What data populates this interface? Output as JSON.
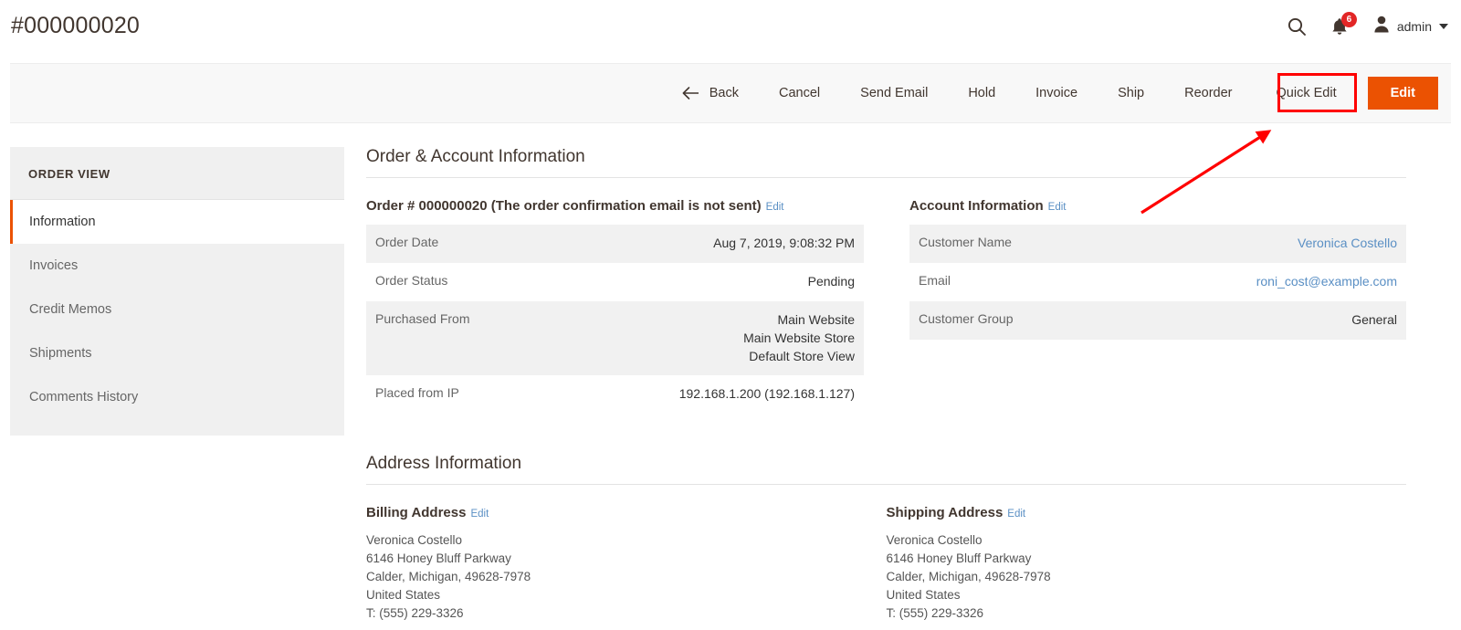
{
  "header": {
    "title": "#000000020",
    "search_icon": "search-icon",
    "notifications_icon": "bell-icon",
    "notifications_count": "6",
    "user_icon": "user-avatar-icon",
    "user_name": "admin",
    "caret_icon": "chevron-down-icon"
  },
  "toolbar": {
    "back_label": "Back",
    "back_icon": "arrow-left-icon",
    "cancel_label": "Cancel",
    "send_email_label": "Send Email",
    "hold_label": "Hold",
    "invoice_label": "Invoice",
    "ship_label": "Ship",
    "reorder_label": "Reorder",
    "quick_edit_label": "Quick Edit",
    "edit_label": "Edit",
    "highlight_color": "#ff0000",
    "primary_color": "#eb5202"
  },
  "sidebar": {
    "title": "ORDER VIEW",
    "items": [
      {
        "label": "Information",
        "active": true
      },
      {
        "label": "Invoices",
        "active": false
      },
      {
        "label": "Credit Memos",
        "active": false
      },
      {
        "label": "Shipments",
        "active": false
      },
      {
        "label": "Comments History",
        "active": false
      }
    ]
  },
  "main": {
    "section_title": "Order & Account Information",
    "order_block": {
      "title": "Order # 000000020 (The order confirmation email is not sent)",
      "edit_label": "Edit",
      "rows": [
        {
          "label": "Order Date",
          "value": "Aug 7, 2019, 9:08:32 PM"
        },
        {
          "label": "Order Status",
          "value": "Pending"
        },
        {
          "label": "Purchased From",
          "value_lines": [
            "Main Website",
            "Main Website Store",
            "Default Store View"
          ]
        },
        {
          "label": "Placed from IP",
          "value": "192.168.1.200 (192.168.1.127)"
        }
      ]
    },
    "account_block": {
      "title": "Account Information",
      "edit_label": "Edit",
      "rows": [
        {
          "label": "Customer Name",
          "value": "Veronica Costello",
          "is_link": true
        },
        {
          "label": "Email",
          "value": "roni_cost@example.com",
          "is_link": true
        },
        {
          "label": "Customer Group",
          "value": "General",
          "is_link": false
        }
      ]
    },
    "address_section_title": "Address Information",
    "billing": {
      "title": "Billing Address",
      "edit_label": "Edit",
      "lines": [
        "Veronica Costello",
        "6146 Honey Bluff Parkway",
        "Calder, Michigan, 49628-7978",
        "United States",
        "T: (555) 229-3326"
      ]
    },
    "shipping": {
      "title": "Shipping Address",
      "edit_label": "Edit",
      "lines": [
        "Veronica Costello",
        "6146 Honey Bluff Parkway",
        "Calder, Michigan, 49628-7978",
        "United States",
        "T: (555) 229-3326"
      ]
    }
  }
}
